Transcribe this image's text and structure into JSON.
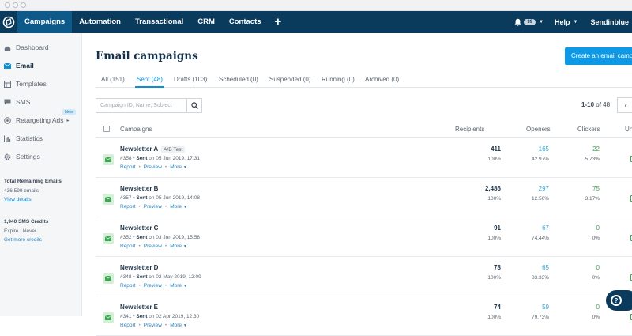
{
  "window": {
    "title": ""
  },
  "nav": {
    "items": [
      "Campaigns",
      "Automation",
      "Transactional",
      "CRM",
      "Contacts"
    ],
    "plus": "+",
    "notif_count": "99",
    "help": "Help",
    "account": "Sendinblue"
  },
  "sidebar": {
    "items": [
      {
        "label": "Dashboard",
        "icon": "dashboard-icon"
      },
      {
        "label": "Email",
        "icon": "email-icon"
      },
      {
        "label": "Templates",
        "icon": "templates-icon"
      },
      {
        "label": "SMS",
        "icon": "sms-icon"
      },
      {
        "label": "Retargeting Ads",
        "icon": "target-icon"
      },
      {
        "label": "Statistics",
        "icon": "statistics-icon"
      },
      {
        "label": "Settings",
        "icon": "gear-icon"
      }
    ],
    "new_badge": "New",
    "emails_title": "Total Remaining Emails",
    "emails_count": "436,599 emails",
    "emails_link": "View details",
    "sms_title": "1,940 SMS Credits",
    "sms_expire": "Expire : Never",
    "sms_link": "Get more credits"
  },
  "main": {
    "title": "Email campaigns",
    "create_button": "Create an email campaign",
    "tabs": [
      "All (151)",
      "Sent (48)",
      "Drafts (103)",
      "Scheduled (0)",
      "Suspended (0)",
      "Running (0)",
      "Archived (0)"
    ],
    "active_tab": 1,
    "search_placeholder": "Campaign ID, Name, Subject",
    "pager_range": "1-10",
    "pager_of": "of 48",
    "columns": [
      "Campaigns",
      "Recipients",
      "Openers",
      "Clickers",
      "Un"
    ],
    "rows": [
      {
        "name": "Newsletter A",
        "tag": "A/B Test",
        "id": "#358",
        "status": "Sent",
        "date": "on 05 Jun 2019, 17:31",
        "recipients": "411",
        "recipients_pct": "100%",
        "openers": "165",
        "openers_pct": "42.97%",
        "clickers": "22",
        "clickers_pct": "5.73%"
      },
      {
        "name": "Newsletter B",
        "tag": "",
        "id": "#357",
        "status": "Sent",
        "date": "on 05 Jun 2019, 14:08",
        "recipients": "2,486",
        "recipients_pct": "100%",
        "openers": "297",
        "openers_pct": "12.56%",
        "clickers": "75",
        "clickers_pct": "3.17%"
      },
      {
        "name": "Newsletter C",
        "tag": "",
        "id": "#352",
        "status": "Sent",
        "date": "on 03 Jun 2019, 15:58",
        "recipients": "91",
        "recipients_pct": "100%",
        "openers": "67",
        "openers_pct": "74.44%",
        "clickers": "0",
        "clickers_pct": "0%"
      },
      {
        "name": "Newsletter D",
        "tag": "",
        "id": "#348",
        "status": "Sent",
        "date": "on 02 May 2019, 12:09",
        "recipients": "78",
        "recipients_pct": "100%",
        "openers": "65",
        "openers_pct": "83.33%",
        "clickers": "0",
        "clickers_pct": "0%"
      },
      {
        "name": "Newsletter E",
        "tag": "",
        "id": "#341",
        "status": "Sent",
        "date": "on 02 Apr 2019, 12:30",
        "recipients": "74",
        "recipients_pct": "100%",
        "openers": "59",
        "openers_pct": "79.73%",
        "clickers": "0",
        "clickers_pct": "0%"
      }
    ],
    "row_links": [
      "Report",
      "Preview",
      "More"
    ]
  },
  "help_label": "?",
  "colors": {
    "nav": "#0a3a5c",
    "accent": "#0d99e6",
    "green": "#3aa852",
    "teal": "#2fa8d8"
  }
}
